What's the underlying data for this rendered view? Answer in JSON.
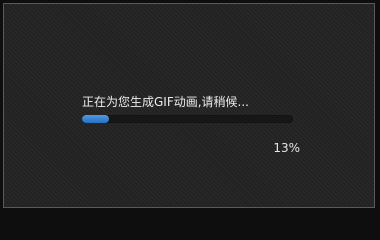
{
  "dialog": {
    "status_text": "正在为您生成GIF动画,请稍候...",
    "progress": {
      "percent_label": "13%",
      "fraction": 0.13
    }
  },
  "colors": {
    "progress_fill": "#2a6fc0",
    "background": "#222222"
  }
}
